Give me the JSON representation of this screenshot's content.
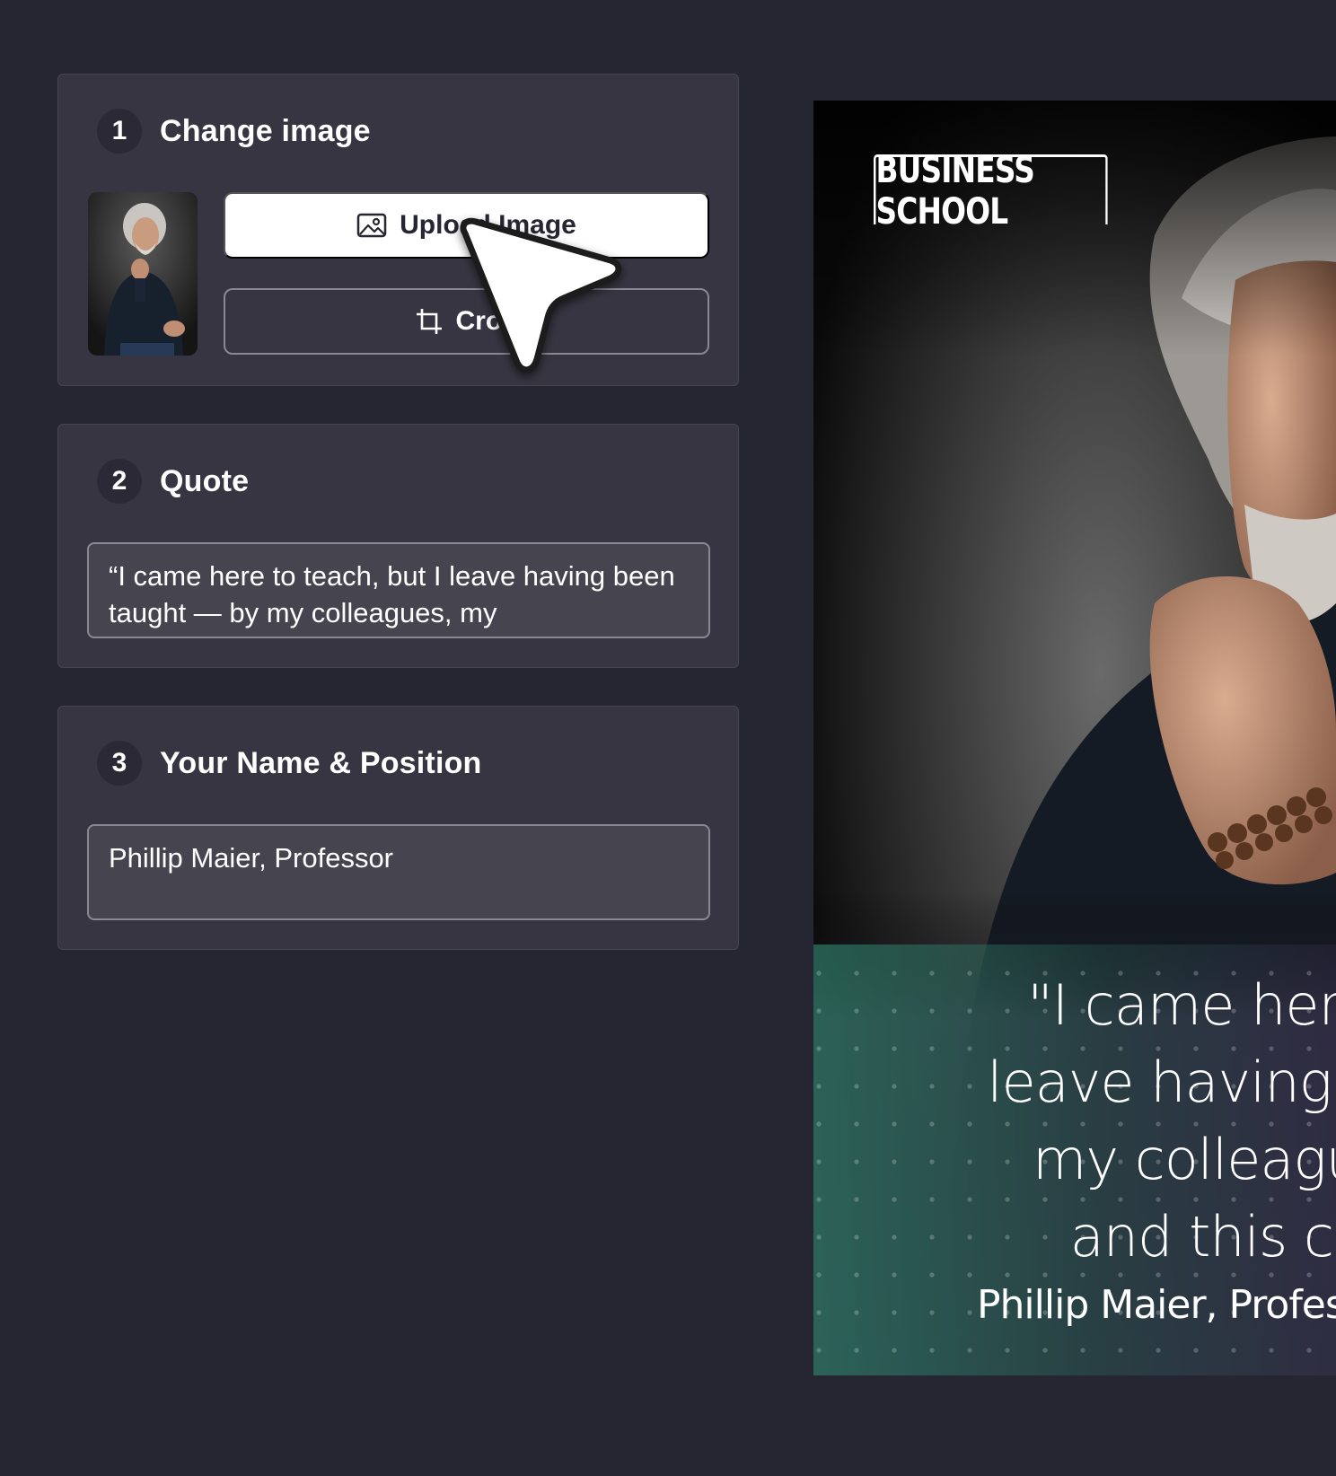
{
  "steps": [
    {
      "number": "1",
      "title": "Change image"
    },
    {
      "number": "2",
      "title": "Quote"
    },
    {
      "number": "3",
      "title": "Your Name & Position"
    }
  ],
  "buttons": {
    "upload_label": "Upload Image",
    "crop_label": "Crop"
  },
  "fields": {
    "quote_value": "“I came here to teach, but  I leave having been taught — by my colleagues, my",
    "name_value": "Phillip Maier, Professor"
  },
  "poster": {
    "badge": "BUSINESS SCHOOL",
    "quote_lines": "\"I came here to\nleave having been\nmy colleagues,\nand this con",
    "name_line": "Phillip Maier, Profess"
  },
  "colors": {
    "page_bg": "#262532",
    "panel_bg": "#363541",
    "field_bg": "#46454f",
    "accent_white": "#ffffff",
    "poster_teal": "#2e7a66"
  },
  "icons": {
    "upload": "image-icon",
    "crop": "crop-icon",
    "pointer": "cursor-arrow-icon"
  }
}
